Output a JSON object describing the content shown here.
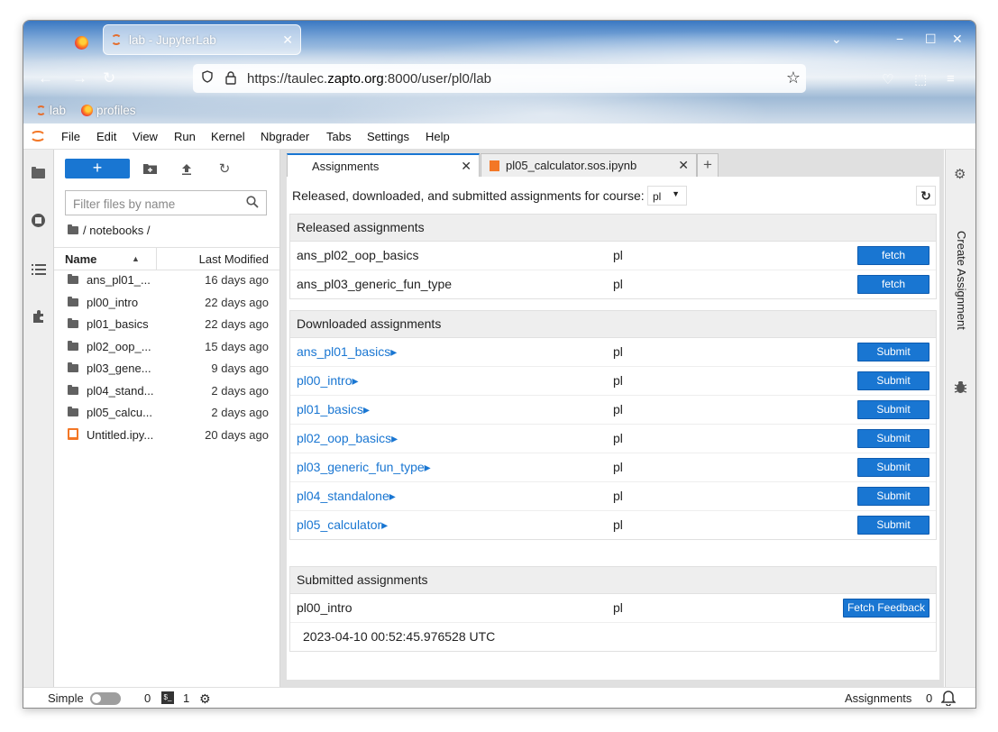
{
  "browser": {
    "tab_title": "lab - JupyterLab",
    "url_prefix": "https://taulec.",
    "url_host": "zapto.org",
    "url_rest": ":8000/user/pl0/lab",
    "bookmarks": [
      "lab",
      "profiles"
    ],
    "icons": {
      "close": "✕",
      "minimize": "−",
      "maximize": "☐",
      "star": "☆",
      "back": "←",
      "forward": "→",
      "reload": "↻",
      "chevron": "⌄",
      "menu": "≡"
    }
  },
  "menubar": {
    "items": [
      "File",
      "Edit",
      "View",
      "Run",
      "Kernel",
      "Nbgrader",
      "Tabs",
      "Settings",
      "Help"
    ]
  },
  "filebrowser": {
    "new_label": "+",
    "filter_placeholder": "Filter files by name",
    "breadcrumb": "/ notebooks /",
    "col_name": "Name",
    "col_modified": "Last Modified",
    "files": [
      {
        "name": "ans_pl01_...",
        "modified": "16 days ago",
        "type": "folder"
      },
      {
        "name": "pl00_intro",
        "modified": "22 days ago",
        "type": "folder"
      },
      {
        "name": "pl01_basics",
        "modified": "22 days ago",
        "type": "folder"
      },
      {
        "name": "pl02_oop_...",
        "modified": "15 days ago",
        "type": "folder"
      },
      {
        "name": "pl03_gene...",
        "modified": "9 days ago",
        "type": "folder"
      },
      {
        "name": "pl04_stand...",
        "modified": "2 days ago",
        "type": "folder"
      },
      {
        "name": "pl05_calcu...",
        "modified": "2 days ago",
        "type": "folder"
      },
      {
        "name": "Untitled.ipy...",
        "modified": "20 days ago",
        "type": "notebook"
      }
    ]
  },
  "doc_tabs": [
    {
      "label": "Assignments",
      "close": "✕"
    },
    {
      "label": "pl05_calculator.sos.ipynb",
      "close": "✕"
    }
  ],
  "add_tab": "+",
  "assignments": {
    "course_text": "Released, downloaded, and submitted assignments for course:",
    "course_value": "pl",
    "released": {
      "title": "Released assignments",
      "rows": [
        {
          "name": "ans_pl02_oop_basics",
          "course": "pl",
          "action": "fetch"
        },
        {
          "name": "ans_pl03_generic_fun_type",
          "course": "pl",
          "action": "fetch"
        }
      ]
    },
    "downloaded": {
      "title": "Downloaded assignments",
      "rows": [
        {
          "name": "ans_pl01_basics",
          "course": "pl",
          "action": "Submit"
        },
        {
          "name": "pl00_intro",
          "course": "pl",
          "action": "Submit"
        },
        {
          "name": "pl01_basics",
          "course": "pl",
          "action": "Submit"
        },
        {
          "name": "pl02_oop_basics",
          "course": "pl",
          "action": "Submit"
        },
        {
          "name": "pl03_generic_fun_type",
          "course": "pl",
          "action": "Submit"
        },
        {
          "name": "pl04_standalone",
          "course": "pl",
          "action": "Submit"
        },
        {
          "name": "pl05_calculator",
          "course": "pl",
          "action": "Submit"
        }
      ]
    },
    "submitted": {
      "title": "Submitted assignments",
      "rows": [
        {
          "name": "pl00_intro",
          "course": "pl",
          "action": "Fetch Feedback",
          "timestamp": "2023-04-10 00:52:45.976528 UTC"
        }
      ]
    }
  },
  "rightbar": {
    "label": "Create Assignment"
  },
  "statusbar": {
    "mode": "Simple",
    "kernels": "0",
    "terminals": "1",
    "terminal_icon": "$_",
    "right_label": "Assignments",
    "notifications": "0"
  }
}
